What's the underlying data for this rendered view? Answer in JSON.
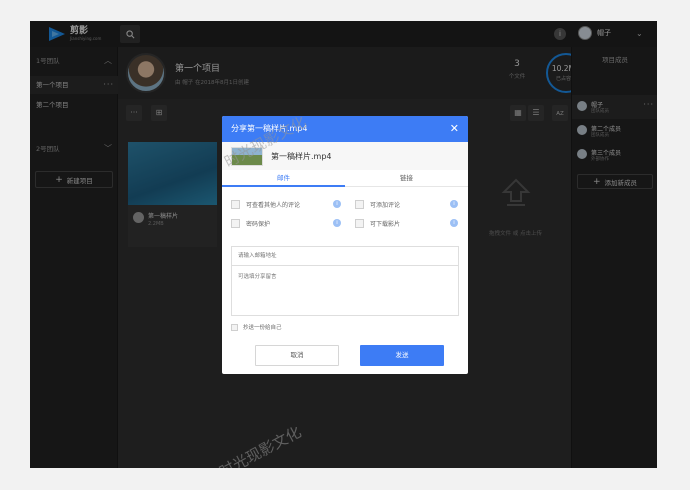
{
  "app": {
    "logo_text": "剪影",
    "logo_sub": "Jianshiying.com"
  },
  "topbar": {
    "user_name": "帽子",
    "notif_badge": "i"
  },
  "leftbar": {
    "team1_label": "1号团队",
    "projects": [
      {
        "label": "第一个项目"
      },
      {
        "label": "第二个项目"
      }
    ],
    "team2_label": "2号团队",
    "new_project_label": "新建项目"
  },
  "project": {
    "title": "第一个项目",
    "meta": "由 帽子 在2018年8月1日创建",
    "file_count": "3",
    "file_count_label": "个文件",
    "storage_value": "10.2MB",
    "storage_label": "已占容量"
  },
  "card": {
    "name": "第一稿样片",
    "size": "2.2MB"
  },
  "upload": {
    "hint": "拖拽文件 或 点击上传"
  },
  "help": {
    "label": "帮助"
  },
  "rightbar": {
    "title": "项目成员",
    "members": [
      {
        "name": "帽子",
        "role": "团队成员"
      },
      {
        "name": "第二个成员",
        "role": "团队成员"
      },
      {
        "name": "第三个成员",
        "role": "外部协作"
      }
    ],
    "add_member_label": "添加新成员"
  },
  "modal": {
    "title": "分享第一稿样片.mp4",
    "file_name": "第一稿样片.mp4",
    "tabs": [
      "邮件",
      "链接"
    ],
    "options": [
      {
        "label": "可查看其他人的评论"
      },
      {
        "label": "可添加评论"
      },
      {
        "label": "密码保护"
      },
      {
        "label": "可下载影片"
      }
    ],
    "email_placeholder": "请输入邮箱地址",
    "message_placeholder": "可选填分享留言",
    "copy_self": "抄送一份给自己",
    "cancel": "取消",
    "send": "发送"
  },
  "watermark": {
    "text": "时光现影文化"
  },
  "colors": {
    "accent": "#3d7cf5",
    "background": "#2b2b2b",
    "sidebar": "#232323"
  }
}
